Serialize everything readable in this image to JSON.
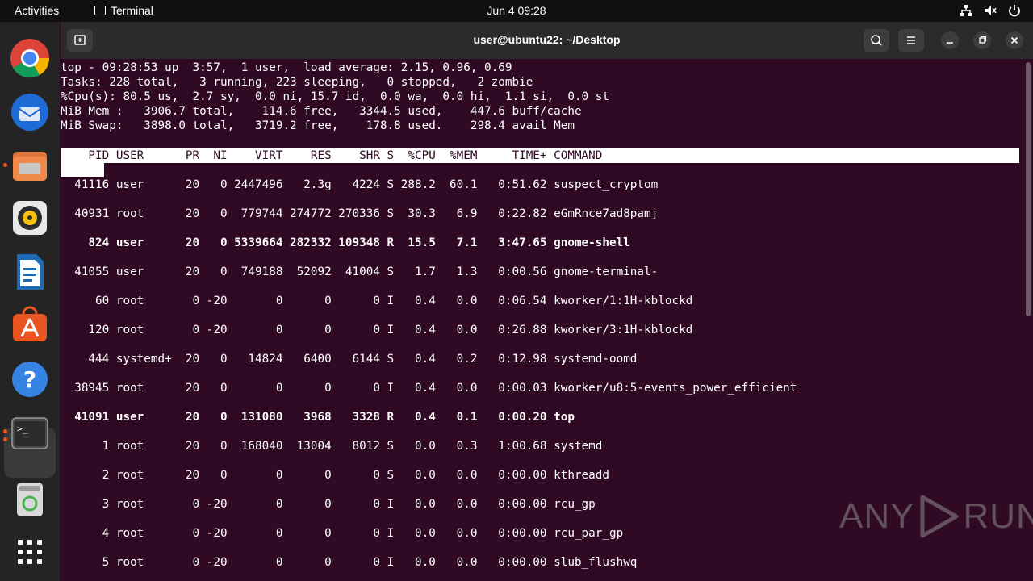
{
  "topbar": {
    "activities": "Activities",
    "app_name": "Terminal",
    "clock": "Jun 4  09:28"
  },
  "dock": {
    "apps": [
      "chrome-icon",
      "thunderbird-icon",
      "files-icon",
      "rhythmbox-icon",
      "libreoffice-writer-icon",
      "app-center-icon",
      "help-icon",
      "terminal-icon",
      "trash-icon",
      "show-apps-icon"
    ]
  },
  "window": {
    "title": "user@ubuntu22: ~/Desktop"
  },
  "top": {
    "summary": [
      "top - 09:28:53 up  3:57,  1 user,  load average: 2.15, 0.96, 0.69",
      "Tasks: 228 total,   3 running, 223 sleeping,   0 stopped,   2 zombie",
      "%Cpu(s): 80.5 us,  2.7 sy,  0.0 ni, 15.7 id,  0.0 wa,  0.0 hi,  1.1 si,  0.0 st",
      "MiB Mem :   3906.7 total,    114.6 free,   3344.5 used,    447.6 buff/cache",
      "MiB Swap:   3898.0 total,   3719.2 free,    178.8 used.    298.4 avail Mem"
    ],
    "header": "    PID USER      PR  NI    VIRT    RES    SHR S  %CPU  %MEM     TIME+ COMMAND",
    "rows": [
      {
        "text": "  41116 user      20   0 2447496   2.3g   4224 S 288.2  60.1   0:51.62 suspect_cryptom",
        "bold": false
      },
      {
        "text": "  40931 root      20   0  779744 274772 270336 S  30.3   6.9   0:22.82 eGmRnce7ad8pamj",
        "bold": false
      },
      {
        "text": "    824 user      20   0 5339664 282332 109348 R  15.5   7.1   3:47.65 gnome-shell",
        "bold": true
      },
      {
        "text": "  41055 user      20   0  749188  52092  41004 S   1.7   1.3   0:00.56 gnome-terminal-",
        "bold": false
      },
      {
        "text": "     60 root       0 -20       0      0      0 I   0.4   0.0   0:06.54 kworker/1:1H-kblockd",
        "bold": false
      },
      {
        "text": "    120 root       0 -20       0      0      0 I   0.4   0.0   0:26.88 kworker/3:1H-kblockd",
        "bold": false
      },
      {
        "text": "    444 systemd+  20   0   14824   6400   6144 S   0.4   0.2   0:12.98 systemd-oomd",
        "bold": false
      },
      {
        "text": "  38945 root      20   0       0      0      0 I   0.4   0.0   0:00.03 kworker/u8:5-events_power_efficient",
        "bold": false
      },
      {
        "text": "  41091 user      20   0  131080   3968   3328 R   0.4   0.1   0:00.20 top",
        "bold": true
      },
      {
        "text": "      1 root      20   0  168040  13004   8012 S   0.0   0.3   1:00.68 systemd",
        "bold": false
      },
      {
        "text": "      2 root      20   0       0      0      0 S   0.0   0.0   0:00.00 kthreadd",
        "bold": false
      },
      {
        "text": "      3 root       0 -20       0      0      0 I   0.0   0.0   0:00.00 rcu_gp",
        "bold": false
      },
      {
        "text": "      4 root       0 -20       0      0      0 I   0.0   0.0   0:00.00 rcu_par_gp",
        "bold": false
      },
      {
        "text": "      5 root       0 -20       0      0      0 I   0.0   0.0   0:00.00 slub_flushwq",
        "bold": false
      }
    ]
  },
  "watermark": {
    "left": "ANY",
    "right": "RUN"
  }
}
